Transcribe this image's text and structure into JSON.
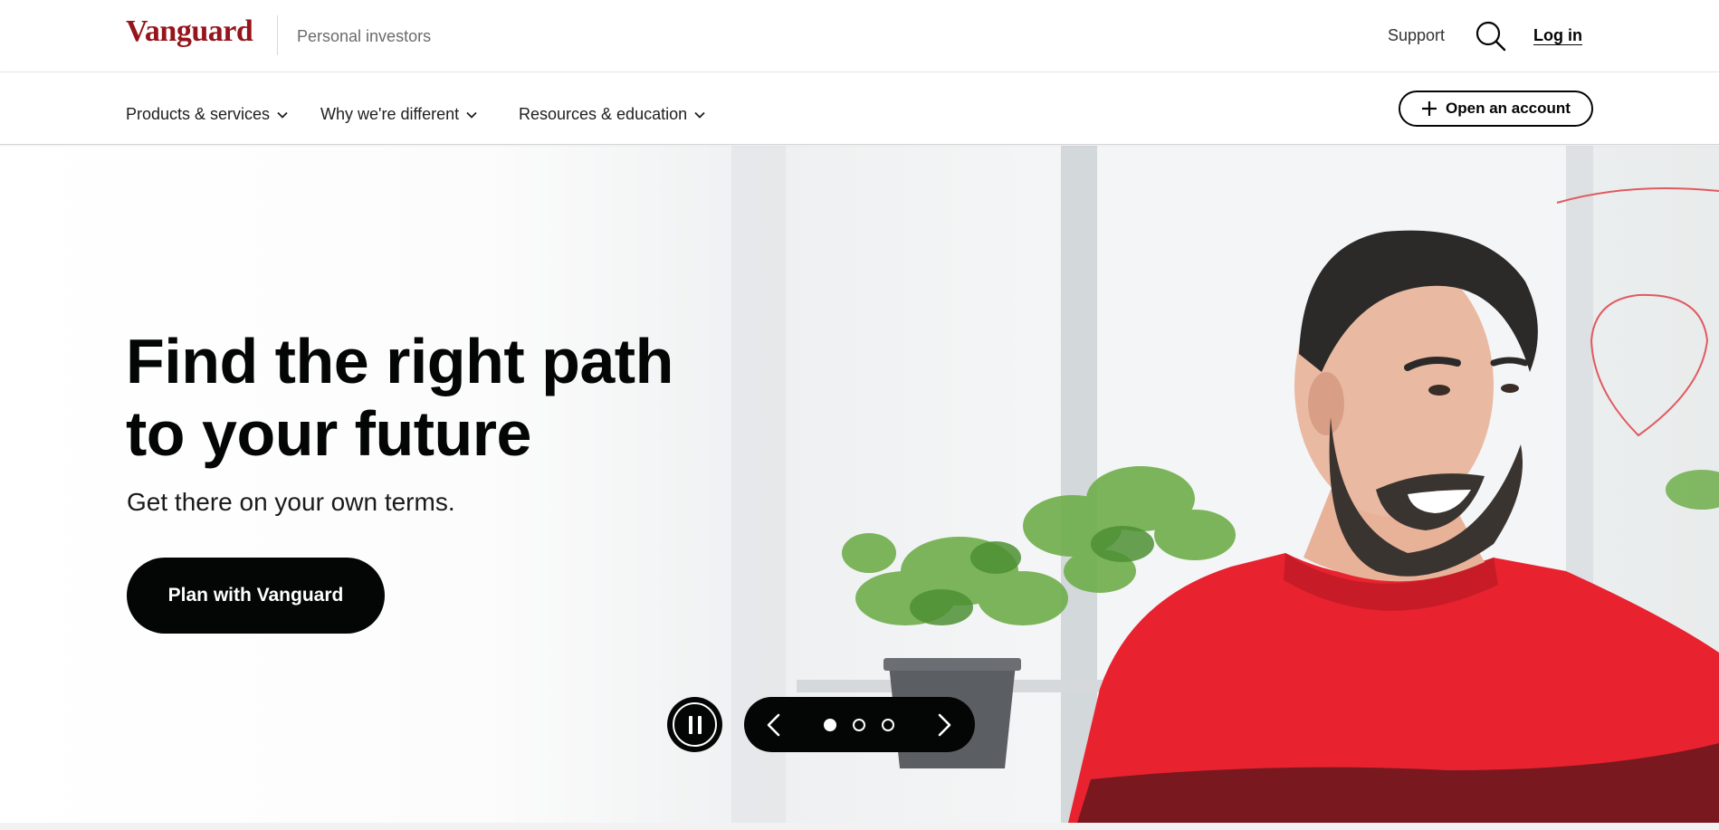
{
  "brand": {
    "logo_text": "Vanguard",
    "segment": "Personal investors",
    "color": "#96151d"
  },
  "utility_nav": {
    "support": "Support",
    "search_icon": "search-icon",
    "login": "Log in"
  },
  "main_nav": {
    "items": [
      {
        "label": "Products & services"
      },
      {
        "label": "Why we're different"
      },
      {
        "label": "Resources & education"
      }
    ],
    "open_account": "Open an account"
  },
  "hero": {
    "title_line1": "Find the right path",
    "title_line2": "to your future",
    "subtitle": "Get there on your own terms.",
    "cta": "Plan with Vanguard",
    "carousel": {
      "slides": 3,
      "active": 1
    }
  },
  "colors": {
    "accent": "#96151d",
    "ink": "#040505",
    "sweater": "#e8232f"
  }
}
